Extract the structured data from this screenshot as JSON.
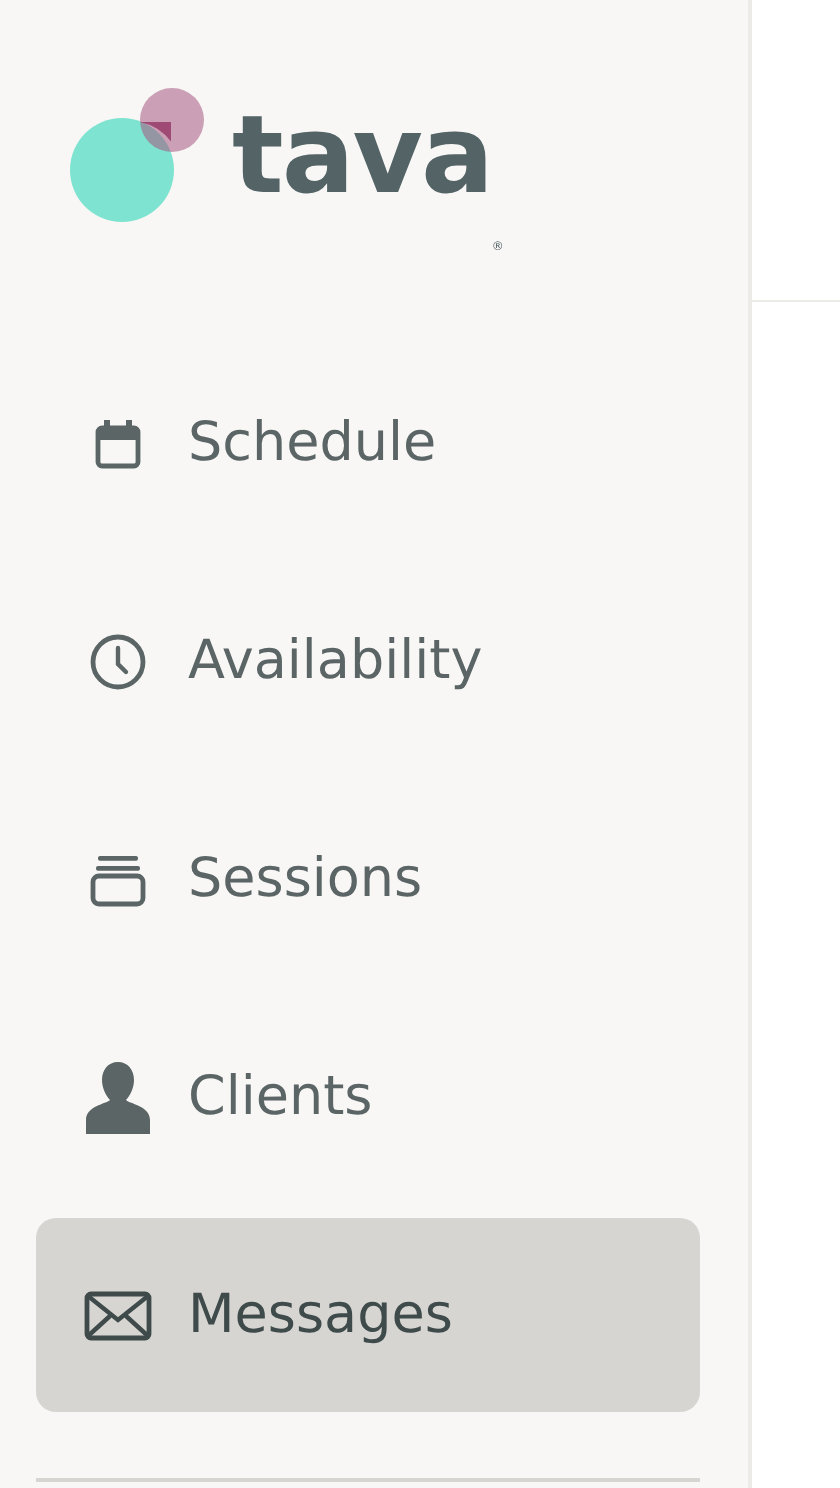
{
  "logo": {
    "text": "tava",
    "mark": "®"
  },
  "nav": [
    {
      "label": "Schedule",
      "kind": "calendar",
      "selected": false
    },
    {
      "label": "Availability",
      "kind": "clock",
      "selected": false
    },
    {
      "label": "Sessions",
      "kind": "stack",
      "selected": false
    },
    {
      "label": "Clients",
      "kind": "person",
      "selected": false
    },
    {
      "label": "Messages",
      "kind": "mail",
      "selected": true
    }
  ]
}
